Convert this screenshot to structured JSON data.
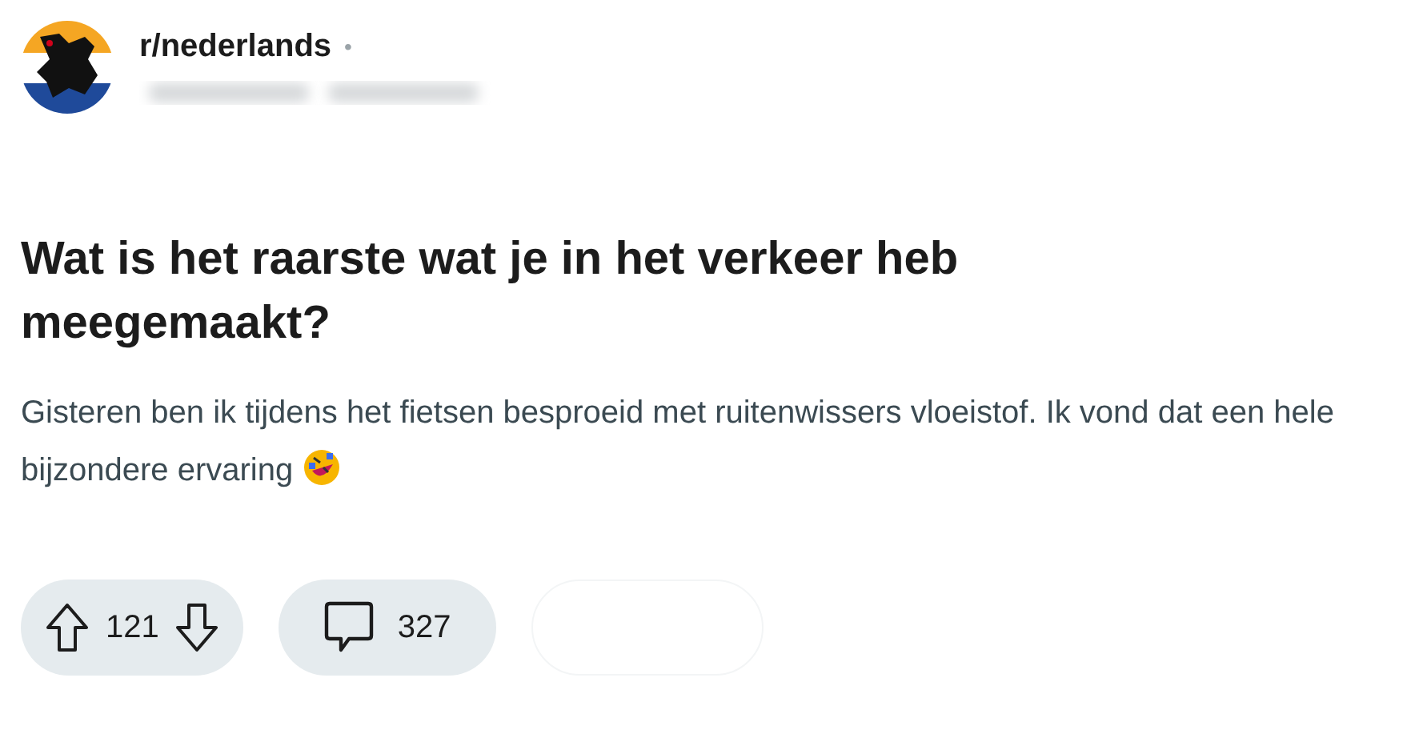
{
  "post": {
    "subreddit": "r/nederlands",
    "separator": "•",
    "title": "Wat is het raarste wat je in het verkeer heb meegemaakt?",
    "body": "Gisteren ben ik tijdens het fietsen besproeid met ruitenwissers vloeistof. Ik vond dat een hele bijzondere ervaring"
  },
  "actions": {
    "votes": "121",
    "comments": "327"
  }
}
